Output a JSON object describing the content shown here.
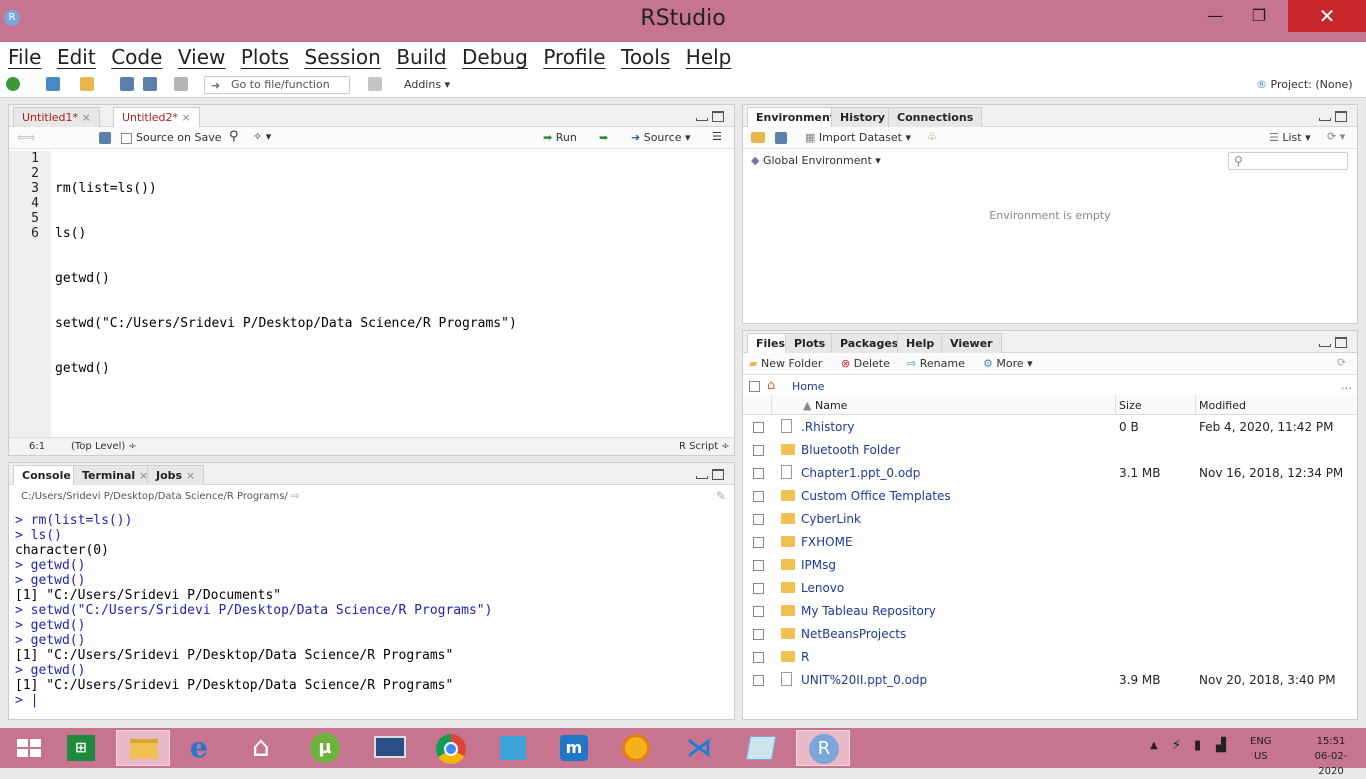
{
  "window": {
    "title": "RStudio",
    "logo_letter": "R"
  },
  "menu": [
    "File",
    "Edit",
    "Code",
    "View",
    "Plots",
    "Session",
    "Build",
    "Debug",
    "Profile",
    "Tools",
    "Help"
  ],
  "toolbar": {
    "goto_placeholder": "Go to file/function",
    "addins": "Addins",
    "project": "Project: (None)"
  },
  "editor": {
    "tabs": [
      {
        "label": "Untitled1*"
      },
      {
        "label": "Untitled2*"
      }
    ],
    "source_on_save": "Source on Save",
    "run": "Run",
    "source": "Source",
    "line_numbers": [
      "1",
      "2",
      "3",
      "4",
      "5",
      "6"
    ],
    "lines": [
      "rm(list=ls())",
      "ls()",
      "getwd()",
      "setwd(\"C:/Users/Sridevi P/Desktop/Data Science/R Programs\")",
      "getwd()",
      ""
    ],
    "status_pos": "6:1",
    "status_scope": "(Top Level) ÷",
    "status_lang": "R Script ÷"
  },
  "console": {
    "tabs": [
      {
        "label": "Console"
      },
      {
        "label": "Terminal"
      },
      {
        "label": "Jobs"
      }
    ],
    "path": "C:/Users/Sridevi P/Desktop/Data Science/R Programs/",
    "lines": [
      {
        "t": "cmd",
        "text": "> rm(list=ls())"
      },
      {
        "t": "cmd",
        "text": "> ls()"
      },
      {
        "t": "out",
        "text": "character(0)"
      },
      {
        "t": "cmd",
        "text": "> getwd()"
      },
      {
        "t": "cmd",
        "text": "> getwd()"
      },
      {
        "t": "out",
        "text": "[1] \"C:/Users/Sridevi P/Documents\""
      },
      {
        "t": "cmd",
        "text": "> setwd(\"C:/Users/Sridevi P/Desktop/Data Science/R Programs\")"
      },
      {
        "t": "cmd",
        "text": "> getwd()"
      },
      {
        "t": "cmd",
        "text": "> getwd()"
      },
      {
        "t": "out",
        "text": "[1] \"C:/Users/Sridevi P/Desktop/Data Science/R Programs\""
      },
      {
        "t": "cmd",
        "text": "> getwd()"
      },
      {
        "t": "out",
        "text": "[1] \"C:/Users/Sridevi P/Desktop/Data Science/R Programs\""
      },
      {
        "t": "cmd",
        "text": "> |"
      }
    ]
  },
  "environment": {
    "tabs": [
      {
        "label": "Environment"
      },
      {
        "label": "History"
      },
      {
        "label": "Connections"
      }
    ],
    "import_dataset": "Import Dataset",
    "list": "List",
    "global_env": "Global Environment",
    "empty_msg": "Environment is empty"
  },
  "files": {
    "tabs": [
      {
        "label": "Files"
      },
      {
        "label": "Plots"
      },
      {
        "label": "Packages"
      },
      {
        "label": "Help"
      },
      {
        "label": "Viewer"
      }
    ],
    "new_folder": "New Folder",
    "delete": "Delete",
    "rename": "Rename",
    "more": "More",
    "home": "Home",
    "col_name": "Name",
    "col_size": "Size",
    "col_modified": "Modified",
    "rows": [
      {
        "name": ".Rhistory",
        "size": "0 B",
        "modified": "Feb 4, 2020, 11:42 PM",
        "type": "file"
      },
      {
        "name": "Bluetooth Folder",
        "size": "",
        "modified": "",
        "type": "folder"
      },
      {
        "name": "Chapter1.ppt_0.odp",
        "size": "3.1 MB",
        "modified": "Nov 16, 2018, 12:34 PM",
        "type": "file"
      },
      {
        "name": "Custom Office Templates",
        "size": "",
        "modified": "",
        "type": "folder"
      },
      {
        "name": "CyberLink",
        "size": "",
        "modified": "",
        "type": "folder"
      },
      {
        "name": "FXHOME",
        "size": "",
        "modified": "",
        "type": "folder"
      },
      {
        "name": "IPMsg",
        "size": "",
        "modified": "",
        "type": "folder"
      },
      {
        "name": "Lenovo",
        "size": "",
        "modified": "",
        "type": "folder"
      },
      {
        "name": "My Tableau Repository",
        "size": "",
        "modified": "",
        "type": "folder"
      },
      {
        "name": "NetBeansProjects",
        "size": "",
        "modified": "",
        "type": "folder"
      },
      {
        "name": "R",
        "size": "",
        "modified": "",
        "type": "folder"
      },
      {
        "name": "UNIT%20II.ppt_0.odp",
        "size": "3.9 MB",
        "modified": "Nov 20, 2018, 3:40 PM",
        "type": "file"
      }
    ]
  },
  "taskbar": {
    "lang1": "ENG",
    "lang2": "US",
    "time": "15:51",
    "date": "06-02-2020",
    "r_letter": "R"
  },
  "colors": {
    "titlebar": "#c6748f",
    "close": "#c8282d",
    "cmd": "#1e25b5",
    "folder": "#f0c152"
  }
}
